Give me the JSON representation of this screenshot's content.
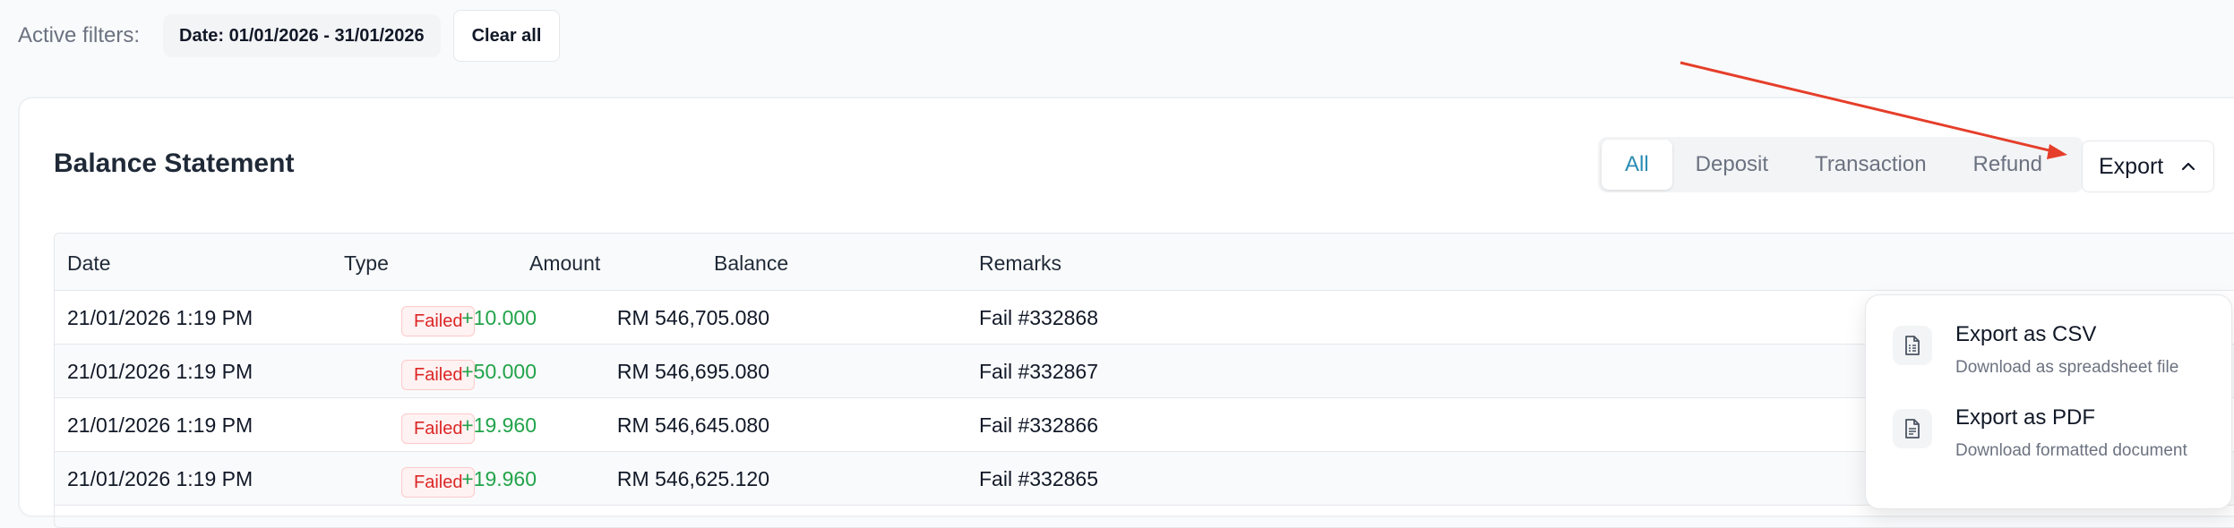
{
  "filters": {
    "label": "Active filters:",
    "chips": [
      "Date: 01/01/2026 - 31/01/2026"
    ],
    "clear_label": "Clear all"
  },
  "card": {
    "title": "Balance Statement",
    "tabs": [
      {
        "label": "All",
        "active": true
      },
      {
        "label": "Deposit",
        "active": false
      },
      {
        "label": "Transaction",
        "active": false
      },
      {
        "label": "Refund",
        "active": false
      }
    ],
    "export_label": "Export"
  },
  "table": {
    "headers": [
      "Date",
      "Type",
      "Amount",
      "Balance",
      "Remarks"
    ],
    "rows": [
      {
        "date": "21/01/2026 1:19 PM",
        "type": "Failed",
        "amount": "+10.000",
        "balance": "RM 546,705.080",
        "remarks": "Fail #332868"
      },
      {
        "date": "21/01/2026 1:19 PM",
        "type": "Failed",
        "amount": "+50.000",
        "balance": "RM 546,695.080",
        "remarks": "Fail #332867"
      },
      {
        "date": "21/01/2026 1:19 PM",
        "type": "Failed",
        "amount": "+19.960",
        "balance": "RM 546,645.080",
        "remarks": "Fail #332866"
      },
      {
        "date": "21/01/2026 1:19 PM",
        "type": "Failed",
        "amount": "+19.960",
        "balance": "RM 546,625.120",
        "remarks": "Fail #332865"
      }
    ]
  },
  "export_menu": {
    "items": [
      {
        "title": "Export as CSV",
        "subtitle": "Download as spreadsheet file",
        "icon": "spreadsheet-file-icon"
      },
      {
        "title": "Export as PDF",
        "subtitle": "Download formatted document",
        "icon": "document-file-icon"
      }
    ]
  },
  "colors": {
    "accent": "#2b8cb4",
    "positive_amount": "#22a34a",
    "failed_badge": "#dc2626",
    "annotation_arrow": "#e53e2a"
  }
}
